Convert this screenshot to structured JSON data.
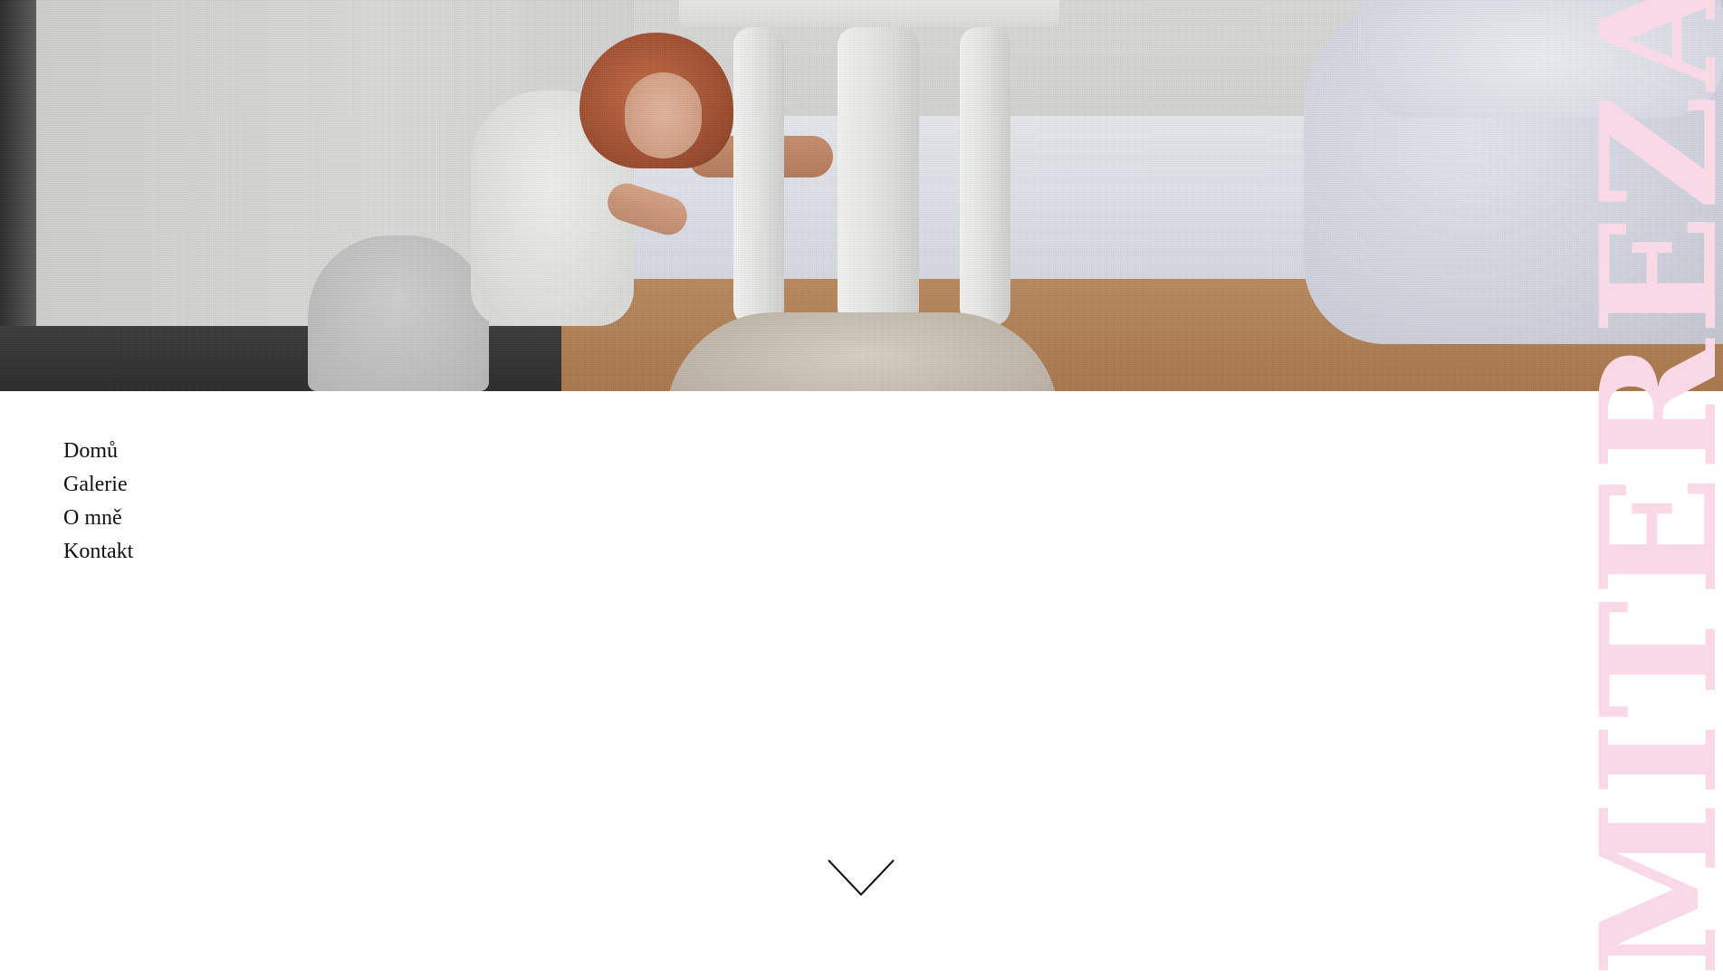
{
  "hero": {
    "image_alt": "Woman resting her head on a bed beside a white chair"
  },
  "brand": {
    "text": "MITEREZA",
    "color": "#fad9e7"
  },
  "nav": {
    "items": [
      {
        "label": "Domů"
      },
      {
        "label": "Galerie"
      },
      {
        "label": "O mně"
      },
      {
        "label": "Kontakt"
      }
    ]
  },
  "scroll": {
    "icon": "chevron-down-icon"
  }
}
